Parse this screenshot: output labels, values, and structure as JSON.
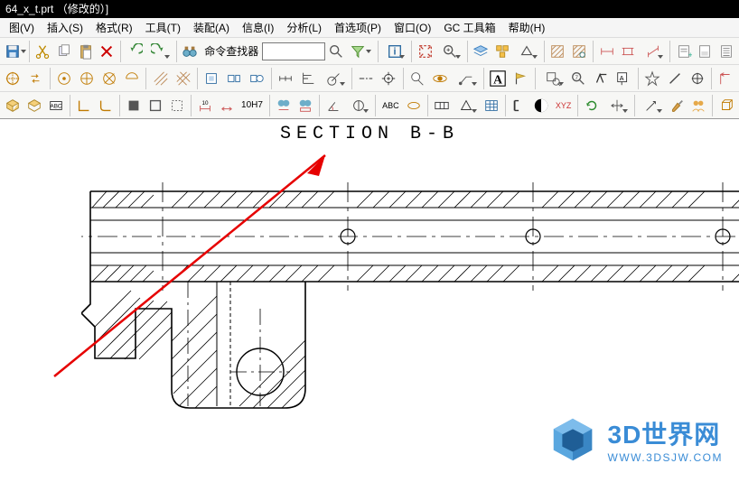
{
  "title": "64_x_t.prt （修改的）]",
  "menu": [
    {
      "label": "图(V)",
      "key": "view"
    },
    {
      "label": "插入(S)",
      "key": "insert"
    },
    {
      "label": "格式(R)",
      "key": "format"
    },
    {
      "label": "工具(T)",
      "key": "tools"
    },
    {
      "label": "装配(A)",
      "key": "assemblies"
    },
    {
      "label": "信息(I)",
      "key": "information"
    },
    {
      "label": "分析(L)",
      "key": "analysis"
    },
    {
      "label": "首选项(P)",
      "key": "preferences"
    },
    {
      "label": "窗口(O)",
      "key": "window"
    },
    {
      "label": "GC 工具箱",
      "key": "gc-toolbox"
    },
    {
      "label": "帮助(H)",
      "key": "help"
    }
  ],
  "toolbar1": {
    "cmd_finder_label": "命令查找器"
  },
  "toolbar3": {
    "tol_label": "10H7",
    "abc_label": "ABC",
    "xyz_label": "XYZ"
  },
  "section_title": "SECTION B-B",
  "watermark": {
    "title": "3D世界网",
    "url": "WWW.3DSJW.COM"
  }
}
